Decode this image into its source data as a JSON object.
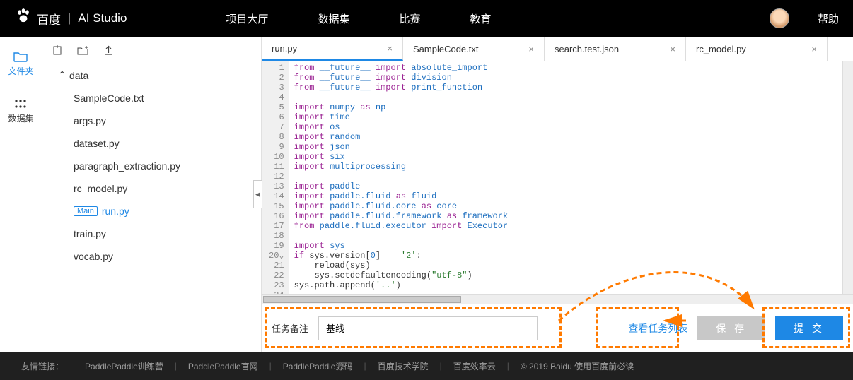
{
  "nav": {
    "brand_cn": "百度",
    "brand_sub": "AI Studio",
    "items": [
      "项目大厅",
      "数据集",
      "比赛",
      "教育"
    ],
    "help": "帮助"
  },
  "rail": {
    "files": "文件夹",
    "datasets": "数据集"
  },
  "tree": {
    "folder": "data",
    "items": [
      "SampleCode.txt",
      "args.py",
      "dataset.py",
      "paragraph_extraction.py",
      "rc_model.py",
      "run.py",
      "train.py",
      "vocab.py"
    ],
    "main_badge": "Main"
  },
  "tabs": [
    {
      "label": "run.py",
      "active": true
    },
    {
      "label": "SampleCode.txt",
      "active": false
    },
    {
      "label": "search.test.json",
      "active": false
    },
    {
      "label": "rc_model.py",
      "active": false
    }
  ],
  "code": {
    "lines": [
      [
        [
          "kw",
          "from"
        ],
        [
          "op",
          " "
        ],
        [
          "mod",
          "__future__"
        ],
        [
          "op",
          " "
        ],
        [
          "kw",
          "import"
        ],
        [
          "op",
          " "
        ],
        [
          "mod",
          "absolute_import"
        ]
      ],
      [
        [
          "kw",
          "from"
        ],
        [
          "op",
          " "
        ],
        [
          "mod",
          "__future__"
        ],
        [
          "op",
          " "
        ],
        [
          "kw",
          "import"
        ],
        [
          "op",
          " "
        ],
        [
          "mod",
          "division"
        ]
      ],
      [
        [
          "kw",
          "from"
        ],
        [
          "op",
          " "
        ],
        [
          "mod",
          "__future__"
        ],
        [
          "op",
          " "
        ],
        [
          "kw",
          "import"
        ],
        [
          "op",
          " "
        ],
        [
          "mod",
          "print_function"
        ]
      ],
      [],
      [
        [
          "kw",
          "import"
        ],
        [
          "op",
          " "
        ],
        [
          "mod",
          "numpy"
        ],
        [
          "op",
          " "
        ],
        [
          "kw",
          "as"
        ],
        [
          "op",
          " "
        ],
        [
          "mod",
          "np"
        ]
      ],
      [
        [
          "kw",
          "import"
        ],
        [
          "op",
          " "
        ],
        [
          "mod",
          "time"
        ]
      ],
      [
        [
          "kw",
          "import"
        ],
        [
          "op",
          " "
        ],
        [
          "mod",
          "os"
        ]
      ],
      [
        [
          "kw",
          "import"
        ],
        [
          "op",
          " "
        ],
        [
          "mod",
          "random"
        ]
      ],
      [
        [
          "kw",
          "import"
        ],
        [
          "op",
          " "
        ],
        [
          "mod",
          "json"
        ]
      ],
      [
        [
          "kw",
          "import"
        ],
        [
          "op",
          " "
        ],
        [
          "mod",
          "six"
        ]
      ],
      [
        [
          "kw",
          "import"
        ],
        [
          "op",
          " "
        ],
        [
          "mod",
          "multiprocessing"
        ]
      ],
      [],
      [
        [
          "kw",
          "import"
        ],
        [
          "op",
          " "
        ],
        [
          "mod",
          "paddle"
        ]
      ],
      [
        [
          "kw",
          "import"
        ],
        [
          "op",
          " "
        ],
        [
          "mod",
          "paddle.fluid"
        ],
        [
          "op",
          " "
        ],
        [
          "kw",
          "as"
        ],
        [
          "op",
          " "
        ],
        [
          "mod",
          "fluid"
        ]
      ],
      [
        [
          "kw",
          "import"
        ],
        [
          "op",
          " "
        ],
        [
          "mod",
          "paddle.fluid.core"
        ],
        [
          "op",
          " "
        ],
        [
          "kw",
          "as"
        ],
        [
          "op",
          " "
        ],
        [
          "mod",
          "core"
        ]
      ],
      [
        [
          "kw",
          "import"
        ],
        [
          "op",
          " "
        ],
        [
          "mod",
          "paddle.fluid.framework"
        ],
        [
          "op",
          " "
        ],
        [
          "kw",
          "as"
        ],
        [
          "op",
          " "
        ],
        [
          "mod",
          "framework"
        ]
      ],
      [
        [
          "kw",
          "from"
        ],
        [
          "op",
          " "
        ],
        [
          "mod",
          "paddle.fluid.executor"
        ],
        [
          "op",
          " "
        ],
        [
          "kw",
          "import"
        ],
        [
          "op",
          " "
        ],
        [
          "mod",
          "Executor"
        ]
      ],
      [],
      [
        [
          "kw",
          "import"
        ],
        [
          "op",
          " "
        ],
        [
          "mod",
          "sys"
        ]
      ],
      [
        [
          "kw",
          "if"
        ],
        [
          "op",
          " sys.version["
        ],
        [
          "num",
          "0"
        ],
        [
          "op",
          "] == "
        ],
        [
          "str",
          "'2'"
        ],
        [
          "op",
          ":"
        ]
      ],
      [
        [
          "op",
          "    reload(sys)"
        ]
      ],
      [
        [
          "op",
          "    sys.setdefaultencoding("
        ],
        [
          "str",
          "\"utf-8\""
        ],
        [
          "op",
          ")"
        ]
      ],
      [
        [
          "op",
          "sys.path.append("
        ],
        [
          "str",
          "'..'"
        ],
        [
          "op",
          ")"
        ]
      ],
      []
    ]
  },
  "action": {
    "label": "任务备注",
    "value": "基线",
    "view_list": "查看任务列表",
    "save": "保 存",
    "submit": "提 交"
  },
  "footer": {
    "label": "友情链接：",
    "links": [
      "PaddlePaddle训练营",
      "PaddlePaddle官网",
      "PaddlePaddle源码",
      "百度技术学院",
      "百度效率云"
    ],
    "copyright": "© 2019 Baidu 使用百度前必读"
  }
}
